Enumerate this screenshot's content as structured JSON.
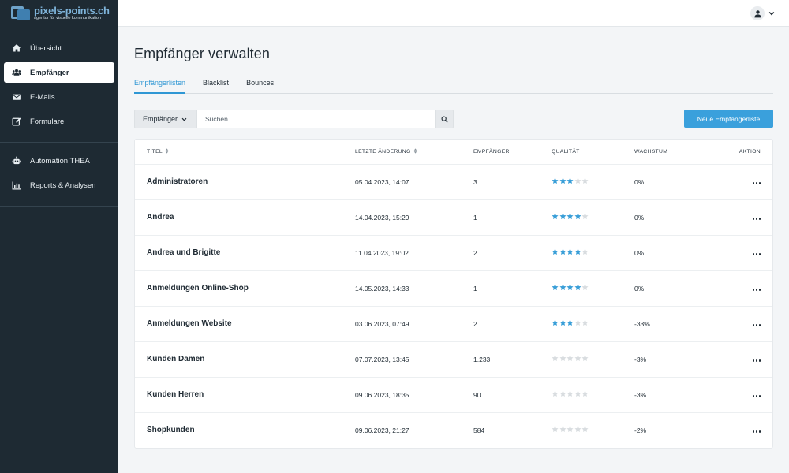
{
  "brand": {
    "name": "pixels-points.ch",
    "tagline": "agentur für visuelle kommunikation"
  },
  "sidebar": {
    "groups": [
      [
        {
          "label": "Übersicht",
          "icon": "home-icon"
        },
        {
          "label": "Empfänger",
          "icon": "users-icon",
          "active": true
        },
        {
          "label": "E-Mails",
          "icon": "envelope-icon"
        },
        {
          "label": "Formulare",
          "icon": "edit-icon"
        }
      ],
      [
        {
          "label": "Automation THEA",
          "icon": "robot-icon"
        },
        {
          "label": "Reports & Analysen",
          "icon": "chart-icon"
        }
      ]
    ]
  },
  "page": {
    "title": "Empfänger verwalten"
  },
  "tabs": [
    {
      "label": "Empfängerlisten",
      "active": true
    },
    {
      "label": "Blacklist"
    },
    {
      "label": "Bounces"
    }
  ],
  "toolbar": {
    "filter_label": "Empfänger",
    "search_placeholder": "Suchen ...",
    "new_button": "Neue Empfängerliste"
  },
  "table": {
    "headers": {
      "title": "TITEL",
      "date": "LETZTE ÄNDERUNG",
      "count": "EMPFÄNGER",
      "quality": "QUALITÄT",
      "growth": "WACHSTUM",
      "action": "AKTION"
    },
    "rows": [
      {
        "title": "Administratoren",
        "date": "05.04.2023, 14:07",
        "count": "3",
        "quality": 3,
        "growth": "0%"
      },
      {
        "title": "Andrea",
        "date": "14.04.2023, 15:29",
        "count": "1",
        "quality": 4,
        "growth": "0%"
      },
      {
        "title": "Andrea und Brigitte",
        "date": "11.04.2023, 19:02",
        "count": "2",
        "quality": 4,
        "growth": "0%"
      },
      {
        "title": "Anmeldungen Online-Shop",
        "date": "14.05.2023, 14:33",
        "count": "1",
        "quality": 4,
        "growth": "0%"
      },
      {
        "title": "Anmeldungen Website",
        "date": "03.06.2023, 07:49",
        "count": "2",
        "quality": 3,
        "growth": "-33%"
      },
      {
        "title": "Kunden Damen",
        "date": "07.07.2023, 13:45",
        "count": "1.233",
        "quality": 0,
        "growth": "-3%"
      },
      {
        "title": "Kunden Herren",
        "date": "09.06.2023, 18:35",
        "count": "90",
        "quality": 0,
        "growth": "-3%"
      },
      {
        "title": "Shopkunden",
        "date": "09.06.2023, 21:27",
        "count": "584",
        "quality": 0,
        "growth": "-2%"
      }
    ]
  },
  "colors": {
    "sidebar_bg": "#1e2a33",
    "accent": "#3aa0dc",
    "star_on": "#3a9fd8",
    "star_off": "#d9dde0"
  }
}
